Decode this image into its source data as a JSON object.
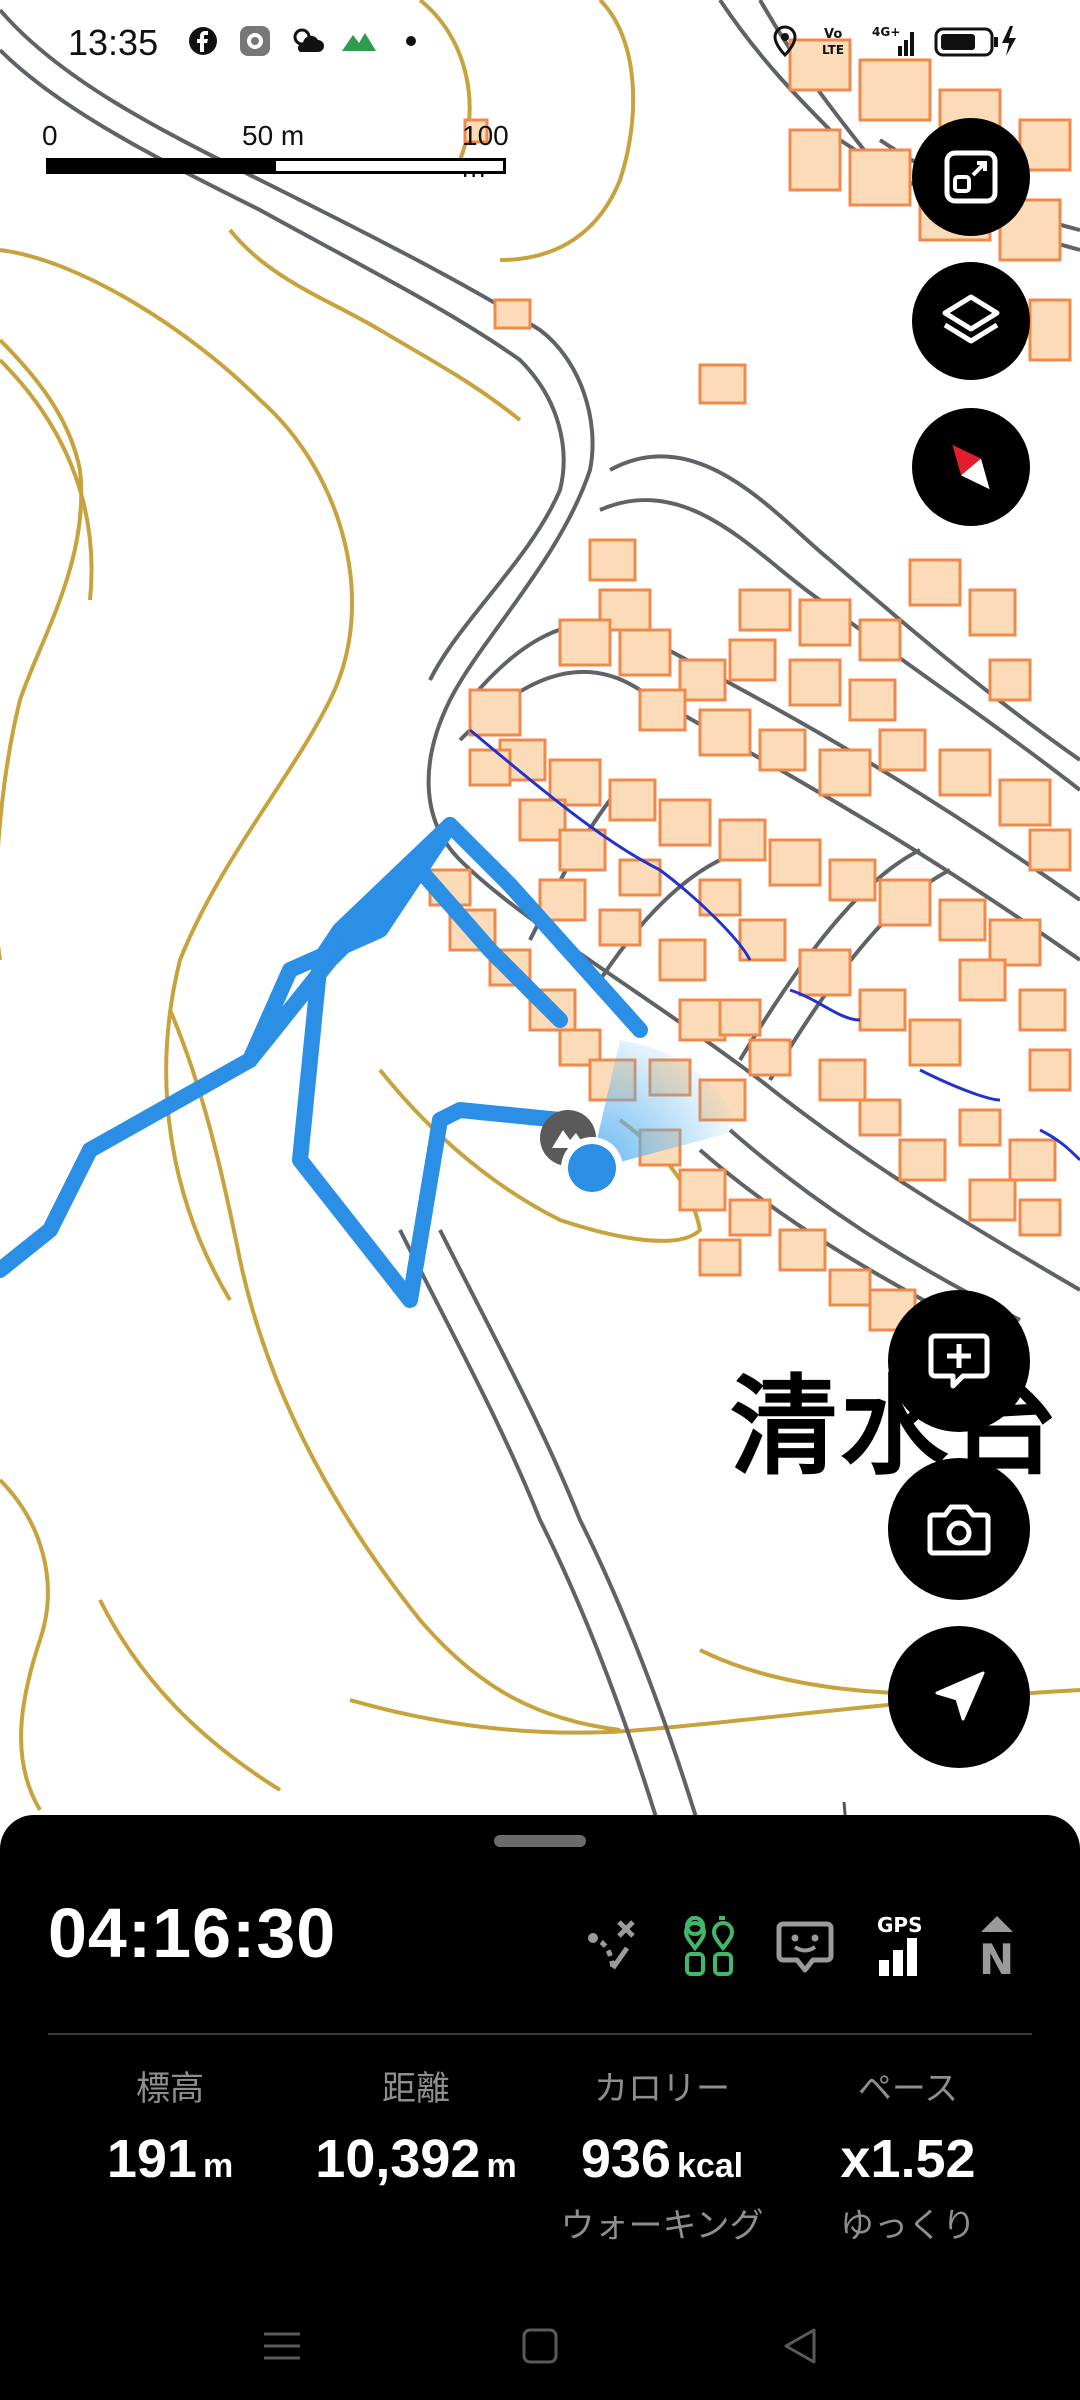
{
  "status_bar": {
    "time": "13:35",
    "left_icons": [
      "facebook-icon",
      "settings-app-icon",
      "weather-icon",
      "mountain-app-icon",
      "dot-icon"
    ],
    "right_icons": [
      "location-icon",
      "volte-icon",
      "4g-signal-icon",
      "battery-charging-icon"
    ],
    "volte_label": "Vo LTE",
    "network_label": "4G+"
  },
  "scale_bar": {
    "label_0": "0",
    "label_50": "50 m",
    "label_100": "100 m"
  },
  "map": {
    "place_label": "清水台",
    "track_color": "#2b8fe6",
    "building_fill": "#fcdcb8",
    "building_stroke": "#f08a4b",
    "contour_color": "#c8a23c",
    "road_color": "#5f6368"
  },
  "fabs": {
    "fit_icon": "fit-screen-icon",
    "layers_icon": "layers-icon",
    "compass_icon": "compass-icon",
    "add_memo_icon": "add-memo-icon",
    "camera_icon": "camera-icon",
    "locate_icon": "navigation-arrow-icon"
  },
  "panel": {
    "timer": "04:16:30",
    "tool_icons": [
      "route-off-icon",
      "waypoints-icon",
      "chat-face-icon",
      "gps-signal-icon",
      "north-up-icon"
    ],
    "gps_label": "GPS",
    "north_label": "N",
    "stats": [
      {
        "label": "標高",
        "value": "191",
        "unit": "m",
        "sub": ""
      },
      {
        "label": "距離",
        "value": "10,392",
        "unit": "m",
        "sub": ""
      },
      {
        "label": "カロリー",
        "value": "936",
        "unit": "kcal",
        "sub": "ウォーキング"
      },
      {
        "label": "ペース",
        "value": "x1.52",
        "unit": "",
        "sub": "ゆっくり"
      }
    ],
    "accent_green": "#3fb86a"
  },
  "nav_bar": {
    "icons": [
      "menu-icon",
      "home-icon",
      "back-icon"
    ]
  }
}
